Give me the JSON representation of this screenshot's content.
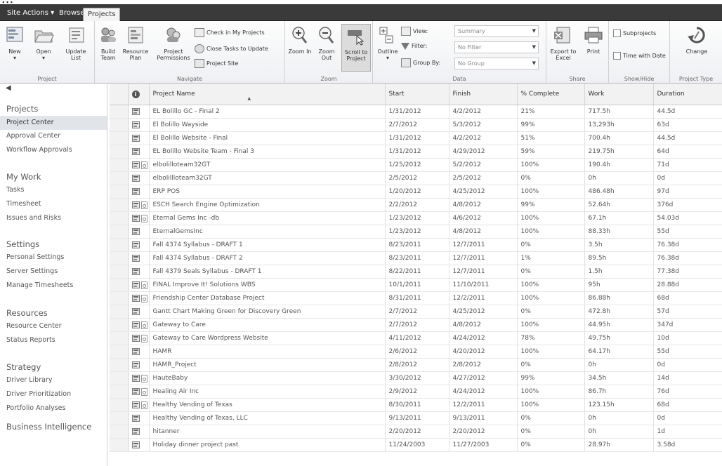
{
  "ribbon_tabs": [
    "Site Actions ▾",
    "Browse",
    "Projects"
  ],
  "groups": {
    "project": {
      "label": "Project",
      "new": "New",
      "open": "Open",
      "update_list": "Update List"
    },
    "navigate": {
      "label": "Navigate",
      "build_team": "Build Team",
      "resource_plan": "Resource Plan",
      "project_permissions": "Project Permissions",
      "check_in": "Check in My Projects",
      "close_tasks": "Close Tasks to Update",
      "project_site": "Project Site"
    },
    "zoom": {
      "label": "Zoom",
      "zoom_in": "Zoom In",
      "zoom_out": "Zoom Out",
      "scroll_to_project": "Scroll to Project"
    },
    "data": {
      "label": "Data",
      "outline": "Outline",
      "view_label": "View:",
      "view_value": "Summary",
      "filter_label": "Filter:",
      "filter_value": "No Filter",
      "groupby_label": "Group By:",
      "groupby_value": "No Group"
    },
    "share": {
      "label": "Share",
      "export": "Export to Excel",
      "print": "Print"
    },
    "showhide": {
      "label": "Show/Hide",
      "subprojects": "Subprojects",
      "time_with_date": "Time with Date"
    },
    "projecttype": {
      "label": "Project Type",
      "change": "Change"
    }
  },
  "nav": {
    "sections": [
      {
        "header": "Projects",
        "items": [
          "Project Center",
          "Approval Center",
          "Workflow Approvals"
        ]
      },
      {
        "header": "My Work",
        "items": [
          "Tasks",
          "Timesheet",
          "Issues and Risks"
        ]
      },
      {
        "header": "Settings",
        "items": [
          "Personal Settings",
          "Server Settings",
          "Manage Timesheets"
        ]
      },
      {
        "header": "Resources",
        "items": [
          "Resource Center",
          "Status Reports"
        ]
      },
      {
        "header": "Strategy",
        "items": [
          "Driver Library",
          "Driver Prioritization",
          "Portfolio Analyses"
        ]
      },
      {
        "header": "Business Intelligence",
        "items": []
      }
    ],
    "selected": "Project Center"
  },
  "table": {
    "columns": [
      "Project Name",
      "Start",
      "Finish",
      "% Complete",
      "Work",
      "Duration"
    ],
    "rows": [
      {
        "name": "EL Bolillo GC - Final 2",
        "start": "1/31/2012",
        "finish": "4/2/2012",
        "pct": "21%",
        "work": "717.5h",
        "dur": "44.5d",
        "checked": false
      },
      {
        "name": "El Bolillo Wayside",
        "start": "2/7/2012",
        "finish": "5/3/2012",
        "pct": "99%",
        "work": "13,293h",
        "dur": "63d",
        "checked": false
      },
      {
        "name": "El Bolillo Website - Final",
        "start": "1/31/2012",
        "finish": "4/2/2012",
        "pct": "51%",
        "work": "700.4h",
        "dur": "44.5d",
        "checked": false
      },
      {
        "name": "EL Bolillo Website Team - Final 3",
        "start": "1/31/2012",
        "finish": "4/29/2012",
        "pct": "59%",
        "work": "219.75h",
        "dur": "64d",
        "checked": false
      },
      {
        "name": "elbolilloteam32GT",
        "start": "1/25/2012",
        "finish": "5/2/2012",
        "pct": "100%",
        "work": "190.4h",
        "dur": "71d",
        "checked": true
      },
      {
        "name": "elbolillloteam32GT",
        "start": "2/5/2012",
        "finish": "2/5/2012",
        "pct": "0%",
        "work": "0h",
        "dur": "0d",
        "checked": false
      },
      {
        "name": "ERP POS",
        "start": "1/20/2012",
        "finish": "4/25/2012",
        "pct": "100%",
        "work": "486.48h",
        "dur": "97d",
        "checked": false
      },
      {
        "name": "ESCH Search Engine Optimization",
        "start": "2/2/2012",
        "finish": "4/8/2012",
        "pct": "99%",
        "work": "52.64h",
        "dur": "376d",
        "checked": true
      },
      {
        "name": "Eternal Gems Inc -db",
        "start": "1/23/2012",
        "finish": "4/6/2012",
        "pct": "100%",
        "work": "67.1h",
        "dur": "54.03d",
        "checked": true
      },
      {
        "name": "EternalGemsInc",
        "start": "1/23/2012",
        "finish": "4/8/2012",
        "pct": "100%",
        "work": "88.33h",
        "dur": "55d",
        "checked": false
      },
      {
        "name": "Fall 4374 Syllabus - DRAFT 1",
        "start": "8/23/2011",
        "finish": "12/7/2011",
        "pct": "0%",
        "work": "3.5h",
        "dur": "76.38d",
        "checked": false
      },
      {
        "name": "Fall 4374 Syllabus - DRAFT 2",
        "start": "8/23/2011",
        "finish": "12/7/2011",
        "pct": "1%",
        "work": "89.5h",
        "dur": "76.38d",
        "checked": false
      },
      {
        "name": "Fall 4379 Seals Syllabus - DRAFT 1",
        "start": "8/22/2011",
        "finish": "12/7/2011",
        "pct": "0%",
        "work": "1.5h",
        "dur": "77.38d",
        "checked": false
      },
      {
        "name": "FINAL Improve It! Solutions WBS",
        "start": "10/1/2011",
        "finish": "11/10/2011",
        "pct": "100%",
        "work": "95h",
        "dur": "28.88d",
        "checked": true
      },
      {
        "name": "Friendship Center Database Project",
        "start": "8/31/2011",
        "finish": "12/2/2011",
        "pct": "100%",
        "work": "86.88h",
        "dur": "68d",
        "checked": true
      },
      {
        "name": "Gantt Chart Making Green for Discovery Green",
        "start": "2/7/2012",
        "finish": "4/25/2012",
        "pct": "0%",
        "work": "472.8h",
        "dur": "57d",
        "checked": false
      },
      {
        "name": "Gateway to Care",
        "start": "2/7/2012",
        "finish": "4/8/2012",
        "pct": "100%",
        "work": "44.95h",
        "dur": "347d",
        "checked": true
      },
      {
        "name": "Gateway to Care Wordpress Website",
        "start": "4/11/2012",
        "finish": "4/24/2012",
        "pct": "78%",
        "work": "49.75h",
        "dur": "10d",
        "checked": true
      },
      {
        "name": "HAMR",
        "start": "2/6/2012",
        "finish": "4/20/2012",
        "pct": "100%",
        "work": "64.17h",
        "dur": "55d",
        "checked": false
      },
      {
        "name": "HAMR_Project",
        "start": "2/8/2012",
        "finish": "2/8/2012",
        "pct": "0%",
        "work": "0h",
        "dur": "0d",
        "checked": false
      },
      {
        "name": "HauteBaby",
        "start": "3/30/2012",
        "finish": "4/27/2012",
        "pct": "99%",
        "work": "34.5h",
        "dur": "14d",
        "checked": true
      },
      {
        "name": "Healing Air Inc",
        "start": "2/9/2012",
        "finish": "4/24/2012",
        "pct": "100%",
        "work": "86.7h",
        "dur": "76d",
        "checked": true
      },
      {
        "name": "Healthy Vending of Texas",
        "start": "8/30/2011",
        "finish": "12/2/2011",
        "pct": "100%",
        "work": "123.15h",
        "dur": "68d",
        "checked": true
      },
      {
        "name": "Healthy Vending of Texas, LLC",
        "start": "9/13/2011",
        "finish": "9/13/2011",
        "pct": "0%",
        "work": "0h",
        "dur": "0d",
        "checked": false
      },
      {
        "name": "hitanner",
        "start": "2/20/2012",
        "finish": "2/20/2012",
        "pct": "0%",
        "work": "0h",
        "dur": "1d",
        "checked": false
      },
      {
        "name": "Holiday dinner project past",
        "start": "11/24/2003",
        "finish": "11/27/2003",
        "pct": "0%",
        "work": "28.97h",
        "dur": "3.58d",
        "checked": false
      }
    ]
  }
}
